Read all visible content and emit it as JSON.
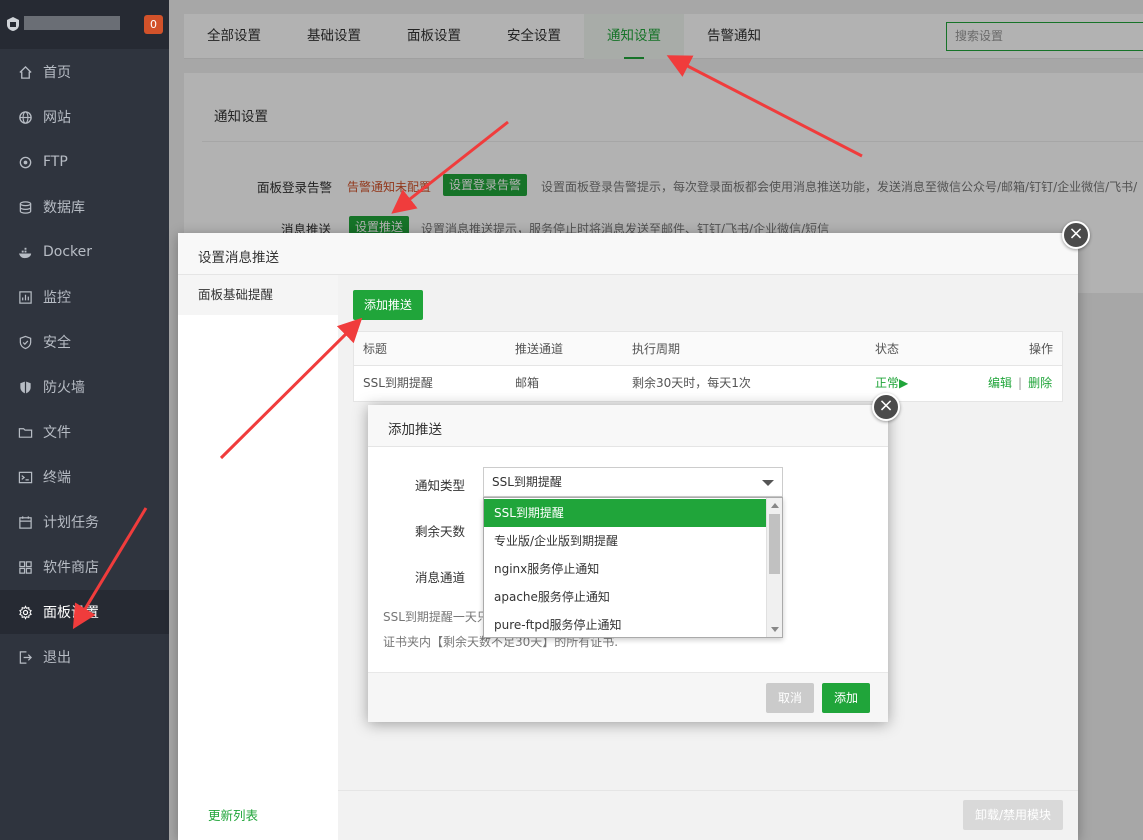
{
  "sidebar": {
    "badge": "0",
    "items": [
      {
        "label": "首页",
        "icon": "home-icon"
      },
      {
        "label": "网站",
        "icon": "globe-icon"
      },
      {
        "label": "FTP",
        "icon": "ftp-icon"
      },
      {
        "label": "数据库",
        "icon": "database-icon"
      },
      {
        "label": "Docker",
        "icon": "docker-icon"
      },
      {
        "label": "监控",
        "icon": "monitor-icon"
      },
      {
        "label": "安全",
        "icon": "shield-icon"
      },
      {
        "label": "防火墙",
        "icon": "firewall-icon"
      },
      {
        "label": "文件",
        "icon": "folder-icon"
      },
      {
        "label": "终端",
        "icon": "terminal-icon"
      },
      {
        "label": "计划任务",
        "icon": "calendar-icon"
      },
      {
        "label": "软件商店",
        "icon": "grid-icon"
      },
      {
        "label": "面板设置",
        "icon": "gear-icon"
      },
      {
        "label": "退出",
        "icon": "logout-icon"
      }
    ],
    "active_label": "面板设置"
  },
  "header": {
    "tabs": [
      {
        "label": "全部设置"
      },
      {
        "label": "基础设置"
      },
      {
        "label": "面板设置"
      },
      {
        "label": "安全设置"
      },
      {
        "label": "通知设置"
      },
      {
        "label": "告警通知"
      }
    ],
    "active_tab": "通知设置",
    "search_placeholder": "搜索设置"
  },
  "notify_panel": {
    "title": "通知设置",
    "login_alert": {
      "label": "面板登录告警",
      "status": "告警通知未配置",
      "button": "设置登录告警",
      "desc": "设置面板登录告警提示，每次登录面板都会使用消息推送功能，发送消息至微信公众号/邮箱/钉钉/企业微信/飞书/"
    },
    "push": {
      "label": "消息推送",
      "button": "设置推送",
      "desc": "设置消息推送提示，服务停止时将消息发送至邮件、钉钉/飞书/企业微信/短信"
    }
  },
  "push_modal": {
    "title": "设置消息推送",
    "side_item": "面板基础提醒",
    "side_footer": "更新列表",
    "add_button": "添加推送",
    "uninstall_button": "卸载/禁用模块",
    "columns": [
      "标题",
      "推送通道",
      "执行周期",
      "状态",
      "操作"
    ],
    "rows": [
      {
        "title": "SSL到期提醒",
        "channel": "邮箱",
        "cycle": "剩余30天时，每天1次",
        "status": "正常▶",
        "edit": "编辑",
        "sep": "|",
        "delete": "删除"
      }
    ]
  },
  "add_modal": {
    "title": "添加推送",
    "type_label": "通知类型",
    "days_label": "剩余天数",
    "channel_label": "消息通道",
    "selected_type": "SSL到期提醒",
    "note_line1": "SSL到期提醒一天只",
    "note_line2": "证书夹内【剩余天数不足30天】的所有证书.",
    "cancel": "取消",
    "add": "添加"
  },
  "dropdown": {
    "options": [
      "SSL到期提醒",
      "专业版/企业版到期提醒",
      "nginx服务停止通知",
      "apache服务停止通知",
      "pure-ftpd服务停止通知"
    ],
    "selected": "SSL到期提醒"
  },
  "colors": {
    "accent": "#20a53a",
    "warning": "#d2522a",
    "sidebar_bg": "#2f343e",
    "arrow": "#f03c3c"
  }
}
